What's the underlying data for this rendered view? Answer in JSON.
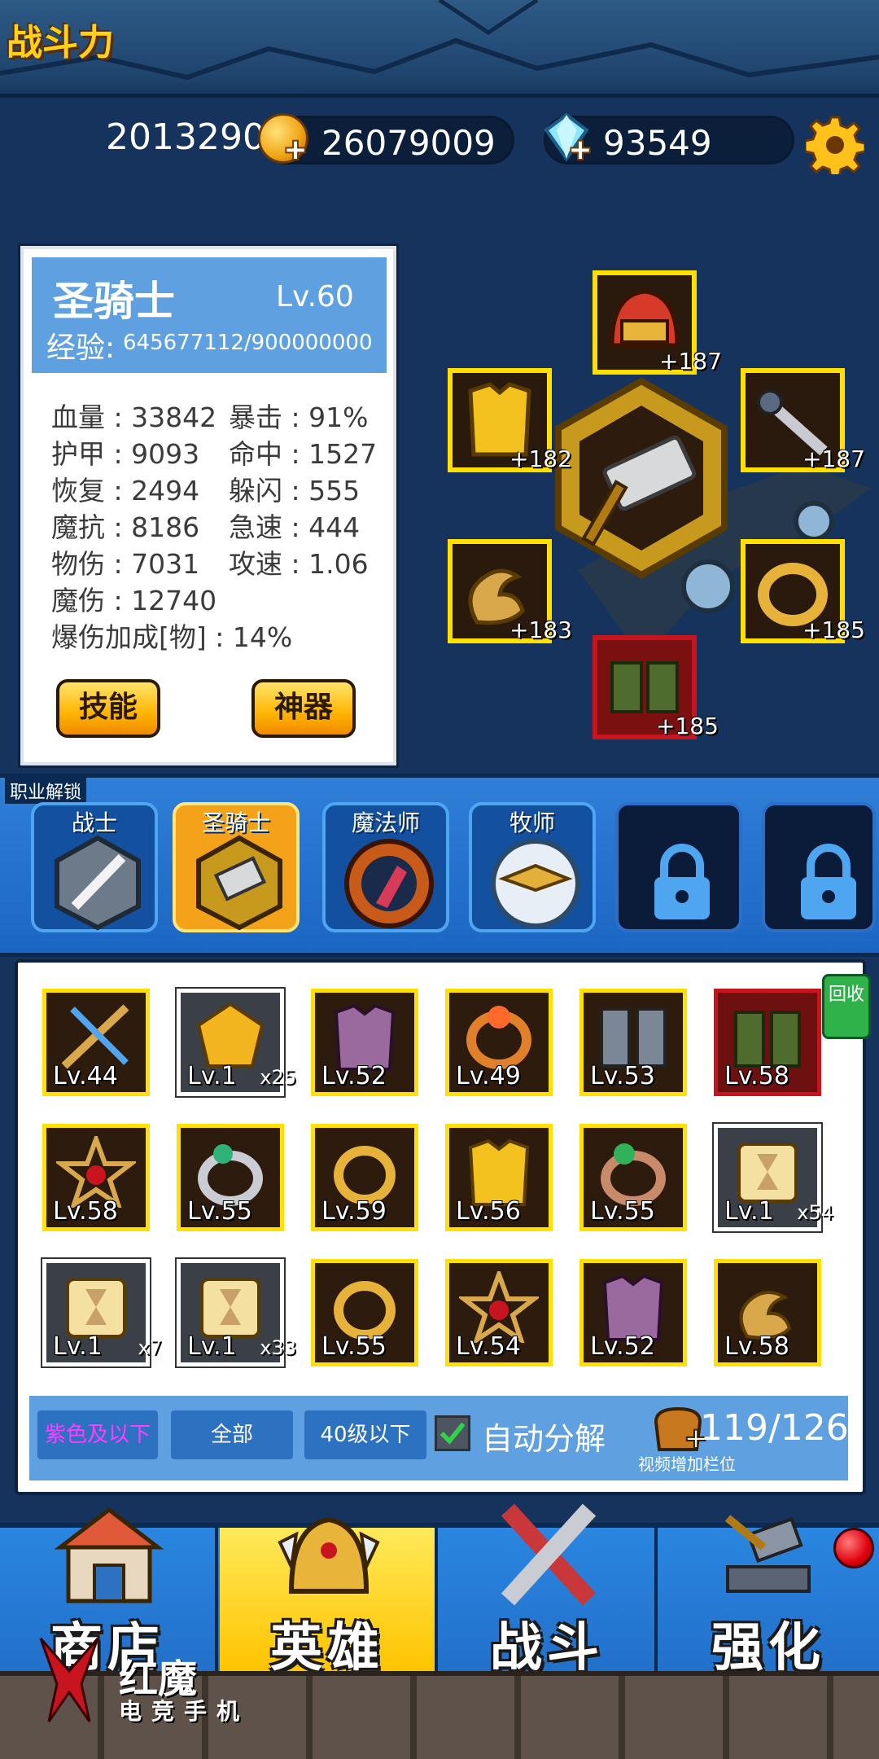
{
  "stats": {
    "power_label": "战斗力",
    "power_value": "2013290",
    "gold": "26079009",
    "gems": "93549"
  },
  "hero": {
    "name": "圣骑士",
    "level": "Lv.60",
    "exp_label": "经验:",
    "exp_value": "645677112/900000000",
    "attributes": [
      {
        "text": "血量 : 33842"
      },
      {
        "text": "暴击 : 91%"
      },
      {
        "text": "护甲 : 9093"
      },
      {
        "text": "命中 : 1527"
      },
      {
        "text": "恢复 : 2494"
      },
      {
        "text": "躲闪 : 555"
      },
      {
        "text": "魔抗 : 8186"
      },
      {
        "text": "急速 : 444"
      },
      {
        "text": "物伤 : 7031"
      },
      {
        "text": "攻速 : 1.06"
      },
      {
        "text": "魔伤 : 12740"
      },
      {
        "text": "爆伤加成[物] : 14%"
      }
    ],
    "skill_button": "技能",
    "artifact_button": "神器"
  },
  "equipment": {
    "helmet_plus": "+187",
    "armor_plus": "+182",
    "weapon2_plus": "+187",
    "amulet_plus": "+183",
    "ring_plus": "+185",
    "boots_plus": "+185"
  },
  "classes": {
    "unlock_label": "职业解锁",
    "tabs": [
      {
        "name": "战士"
      },
      {
        "name": "圣骑士"
      },
      {
        "name": "魔法师"
      },
      {
        "name": "牧师"
      }
    ]
  },
  "inventory": {
    "recycle_label": "回收",
    "items": [
      {
        "lv": "Lv.44",
        "count": ""
      },
      {
        "lv": "Lv.1",
        "count": "x25"
      },
      {
        "lv": "Lv.52",
        "count": ""
      },
      {
        "lv": "Lv.49",
        "count": ""
      },
      {
        "lv": "Lv.53",
        "count": ""
      },
      {
        "lv": "Lv.58",
        "count": ""
      },
      {
        "lv": "Lv.58",
        "count": ""
      },
      {
        "lv": "Lv.55",
        "count": ""
      },
      {
        "lv": "Lv.59",
        "count": ""
      },
      {
        "lv": "Lv.56",
        "count": ""
      },
      {
        "lv": "Lv.55",
        "count": ""
      },
      {
        "lv": "Lv.1",
        "count": "x54"
      },
      {
        "lv": "Lv.1",
        "count": "x7"
      },
      {
        "lv": "Lv.1",
        "count": "x33"
      },
      {
        "lv": "Lv.55",
        "count": ""
      },
      {
        "lv": "Lv.54",
        "count": ""
      },
      {
        "lv": "Lv.52",
        "count": ""
      },
      {
        "lv": "Lv.58",
        "count": ""
      }
    ],
    "filters": {
      "purple": "紫色及以下",
      "all": "全部",
      "level": "40级以下"
    },
    "auto_decompose": "自动分解",
    "auto_decompose_checked": true,
    "capacity": "119/126",
    "video_hint": "视频增加栏位"
  },
  "nav": {
    "shop": "商店",
    "hero": "英雄",
    "battle": "战斗",
    "upgrade": "强化"
  },
  "watermark": {
    "brand": "红魔",
    "sub": "电竞手机"
  },
  "colors": {
    "background": "#15335c",
    "gold": "#ffd21a",
    "slot_border_gold": "#ffe000",
    "slot_border_red": "#c8141e",
    "panel_blue": "#5fa1e0"
  }
}
